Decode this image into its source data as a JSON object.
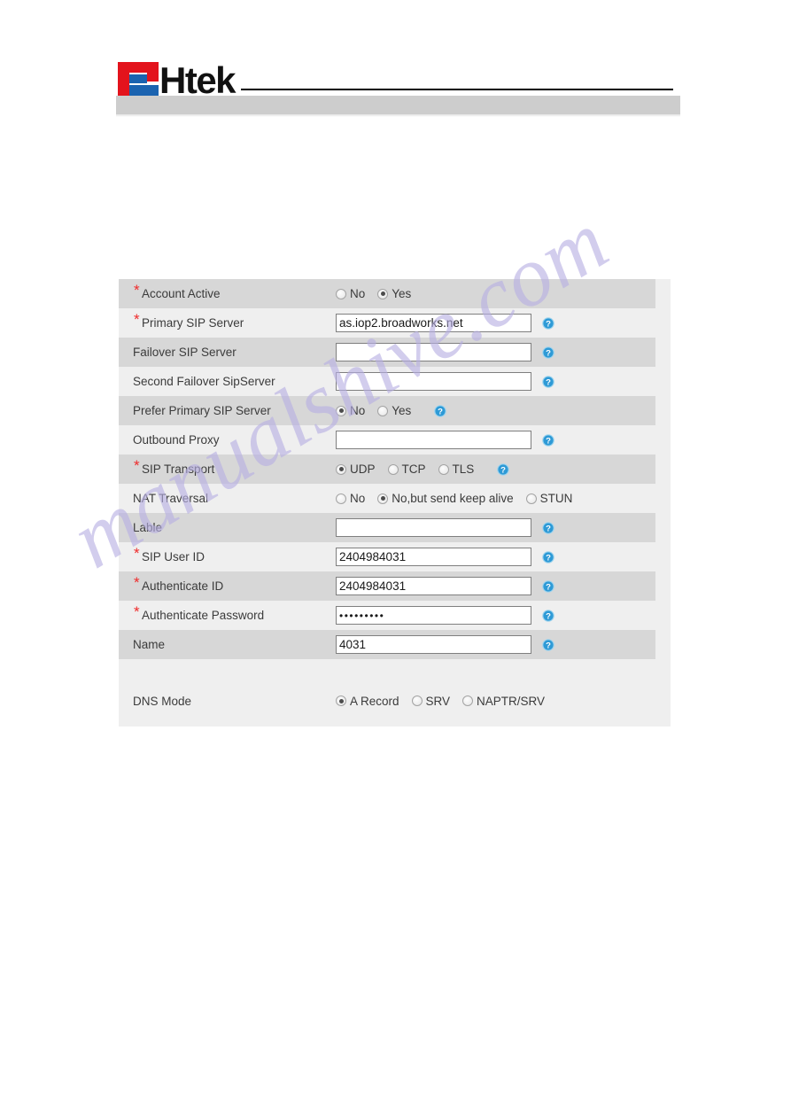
{
  "header": {
    "brand_text": "Htek",
    "logo_name": "htek-logo",
    "brand_red": "#e3131c",
    "brand_blue": "#1b63b0"
  },
  "watermark": {
    "text": "manualshive.com",
    "color": "#b7afe3"
  },
  "form": {
    "rows": [
      {
        "label": "Account Active",
        "required": true,
        "type": "radio",
        "shade": "dark",
        "help": false,
        "options": [
          {
            "label": "No",
            "selected": false
          },
          {
            "label": "Yes",
            "selected": true
          }
        ]
      },
      {
        "label": "Primary SIP Server",
        "required": true,
        "type": "text",
        "shade": "light",
        "help": true,
        "value": "as.iop2.broadworks.net"
      },
      {
        "label": "Failover SIP Server",
        "required": false,
        "type": "text",
        "shade": "dark",
        "help": true,
        "value": ""
      },
      {
        "label": "Second Failover SipServer",
        "required": false,
        "type": "text",
        "shade": "light",
        "help": true,
        "value": ""
      },
      {
        "label": "Prefer Primary SIP Server",
        "required": false,
        "type": "radio",
        "shade": "dark",
        "help": true,
        "options": [
          {
            "label": "No",
            "selected": true
          },
          {
            "label": "Yes",
            "selected": false
          }
        ]
      },
      {
        "label": "Outbound Proxy",
        "required": false,
        "type": "text",
        "shade": "light",
        "help": true,
        "value": ""
      },
      {
        "label": "SIP Transport",
        "required": true,
        "type": "radio",
        "shade": "dark",
        "help": true,
        "options": [
          {
            "label": "UDP",
            "selected": true
          },
          {
            "label": "TCP",
            "selected": false
          },
          {
            "label": "TLS",
            "selected": false
          }
        ]
      },
      {
        "label": "NAT Traversal",
        "required": false,
        "type": "radio",
        "shade": "light",
        "help": false,
        "options": [
          {
            "label": "No",
            "selected": false
          },
          {
            "label": "No,but send keep alive",
            "selected": true
          },
          {
            "label": "STUN",
            "selected": false
          }
        ]
      },
      {
        "label": "Lable",
        "required": false,
        "type": "text",
        "shade": "dark",
        "help": true,
        "value": ""
      },
      {
        "label": "SIP User ID",
        "required": true,
        "type": "text",
        "shade": "light",
        "help": true,
        "value": "2404984031"
      },
      {
        "label": "Authenticate ID",
        "required": true,
        "type": "text",
        "shade": "dark",
        "help": true,
        "value": "2404984031"
      },
      {
        "label": "Authenticate Password",
        "required": true,
        "type": "text",
        "shade": "light",
        "help": true,
        "masked": true,
        "value": "•••••••••"
      },
      {
        "label": "Name",
        "required": false,
        "type": "text",
        "shade": "dark",
        "help": true,
        "value": "4031"
      }
    ],
    "dns_row": {
      "label": "DNS Mode",
      "required": false,
      "type": "radio",
      "help": false,
      "options": [
        {
          "label": "A Record",
          "selected": true
        },
        {
          "label": "SRV",
          "selected": false
        },
        {
          "label": "NAPTR/SRV",
          "selected": false
        }
      ]
    }
  }
}
